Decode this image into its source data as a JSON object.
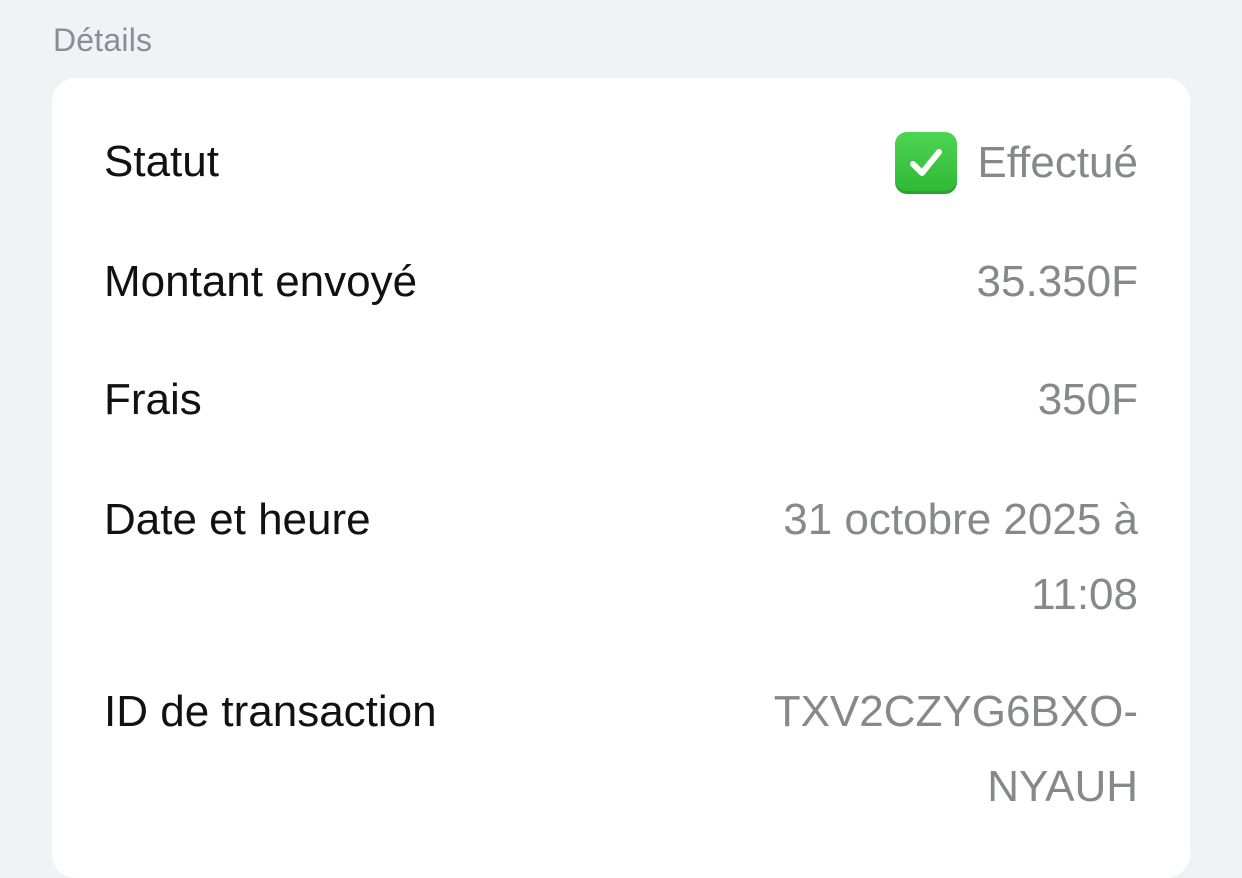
{
  "section": {
    "title": "Détails"
  },
  "details": {
    "status": {
      "label": "Statut",
      "value": "Effectué",
      "icon": "check-box-icon",
      "icon_color": "#34c23a"
    },
    "amount": {
      "label": "Montant envoyé",
      "value": "35.350F"
    },
    "fees": {
      "label": "Frais",
      "value": "350F"
    },
    "datetime": {
      "label": "Date et heure",
      "value_line1": "31 octobre 2025 à",
      "value_line2": "11:08"
    },
    "transaction_id": {
      "label": "ID de transaction",
      "value_line1": "TXV2CZYG6BXO-",
      "value_line2": "NYAUH"
    }
  }
}
